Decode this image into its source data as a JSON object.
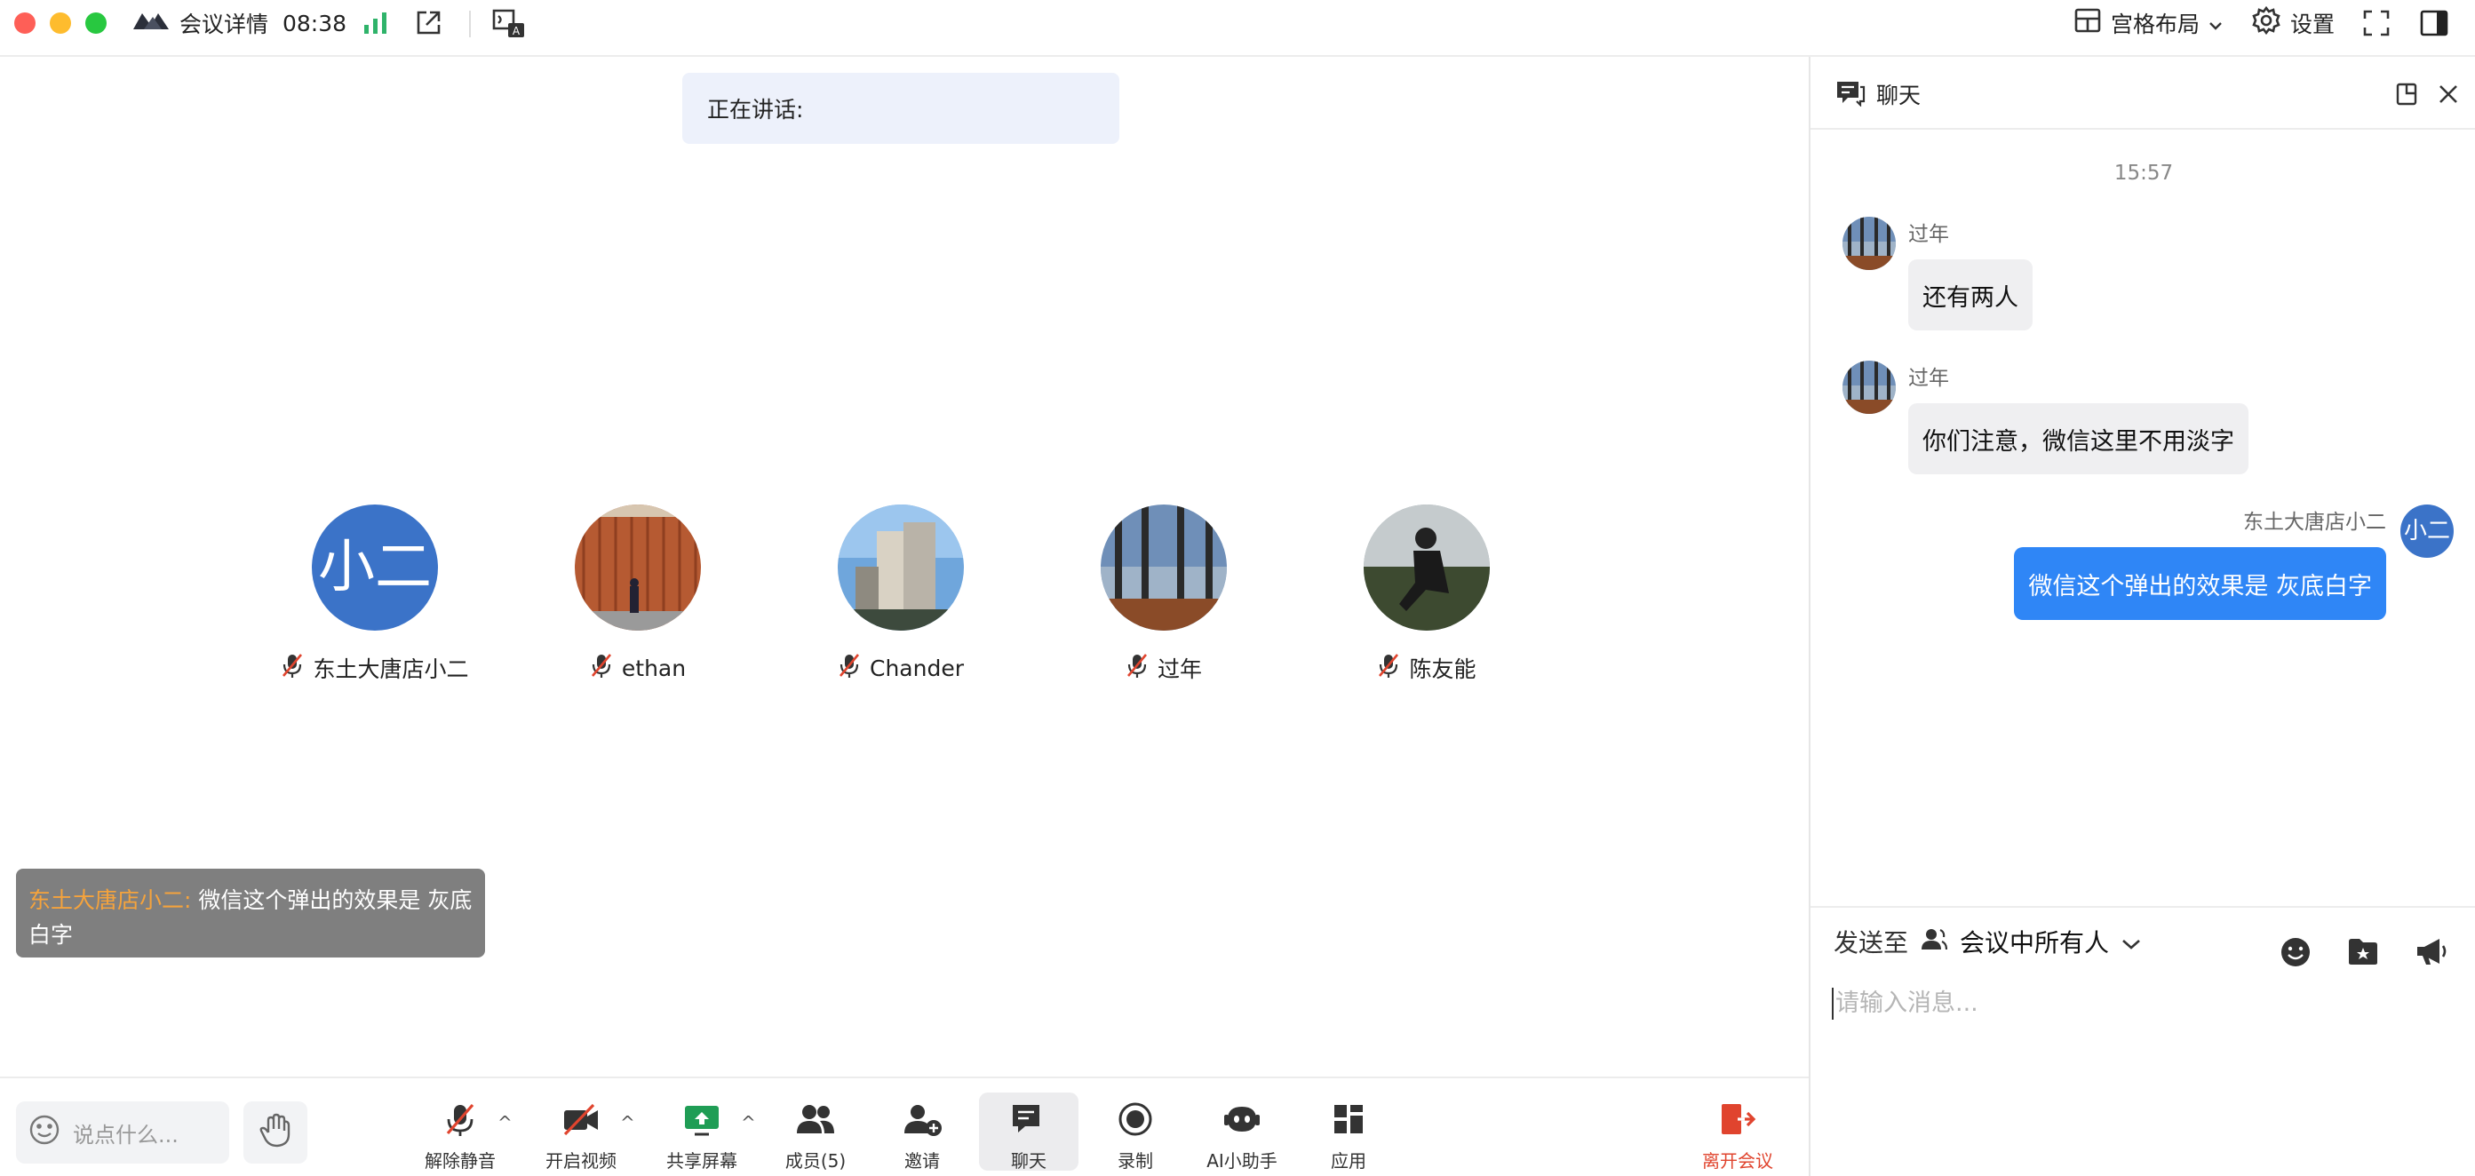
{
  "titlebar": {
    "meeting_details": "会议详情",
    "time": "08:38",
    "layout_label": "宫格布局",
    "settings_label": "设置"
  },
  "speaking": {
    "label": "正在讲话:"
  },
  "participants": [
    {
      "name": "东土大唐店小二",
      "avatar_text": "小二"
    },
    {
      "name": "ethan"
    },
    {
      "name": "Chander"
    },
    {
      "name": "过年"
    },
    {
      "name": "陈友能"
    }
  ],
  "toast": {
    "sender": "东土大唐店小二:",
    "text": "微信这个弹出的效果是 灰底白字"
  },
  "toolbar": {
    "say_placeholder": "说点什么...",
    "unmute": "解除静音",
    "start_video": "开启视频",
    "share_screen": "共享屏幕",
    "members": "成员(5)",
    "invite": "邀请",
    "chat": "聊天",
    "record": "录制",
    "ai_assistant": "AI小助手",
    "apps": "应用",
    "leave": "离开会议"
  },
  "chat": {
    "title": "聊天",
    "timestamp": "15:57",
    "messages": [
      {
        "sender": "过年",
        "text": "还有两人"
      },
      {
        "sender": "过年",
        "text": "你们注意，微信这里不用淡字"
      },
      {
        "sender": "东土大唐店小二",
        "avatar_text": "小二",
        "text": "微信这个弹出的效果是 灰底白字"
      }
    ],
    "send_to_label": "发送至",
    "send_to_target": "会议中所有人",
    "input_placeholder": "请输入消息..."
  },
  "colors": {
    "accent_blue": "#2f86f6",
    "avatar_blue": "#3b73c8",
    "leave_red": "#e0442e",
    "toast_sender": "#f5a33c",
    "signal_green": "#2fb36a"
  }
}
